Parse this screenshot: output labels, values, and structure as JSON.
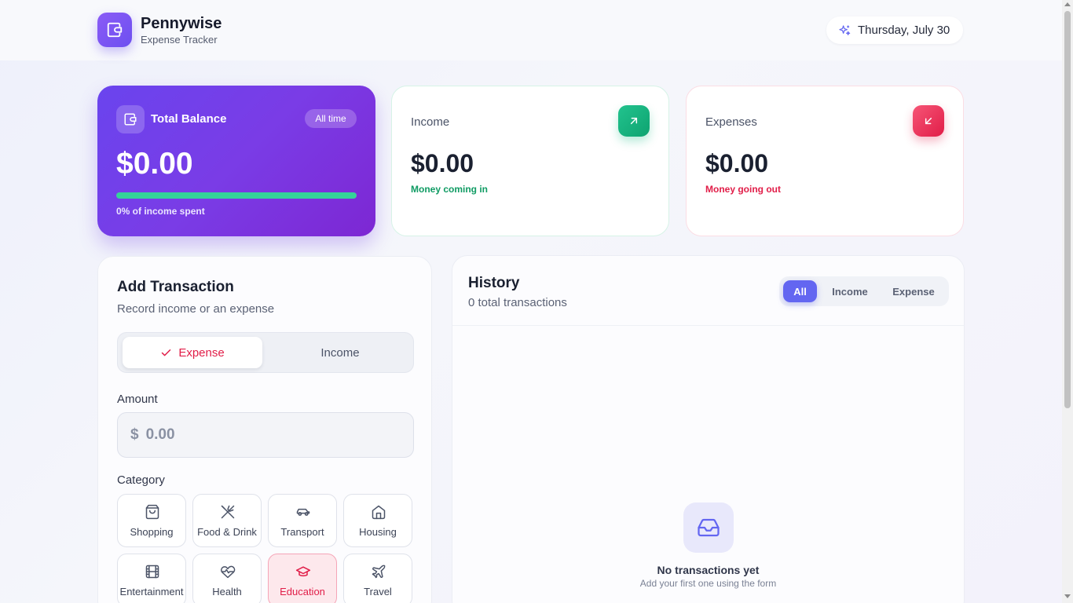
{
  "app": {
    "name": "Pennywise",
    "subtitle": "Expense Tracker",
    "date": "Thursday, July 30",
    "logo_icon": "wallet-icon",
    "date_icon": "sparkles-icon"
  },
  "balance": {
    "title": "Total Balance",
    "pill": "All time",
    "amount": "$0.00",
    "spent_fraction": 0,
    "note": "0% of income spent",
    "icon": "wallet-icon"
  },
  "income": {
    "label": "Income",
    "amount": "$0.00",
    "note": "Money coming in",
    "icon": "arrow-up-right-icon",
    "color": "#10b981"
  },
  "expenses": {
    "label": "Expenses",
    "amount": "$0.00",
    "note": "Money going out",
    "icon": "arrow-down-left-icon",
    "color": "#e11d48"
  },
  "form": {
    "title": "Add Transaction",
    "subtitle": "Record income or an expense",
    "type_toggle": {
      "expense": "Expense",
      "income": "Income",
      "selected": "Expense"
    },
    "amount_label": "Amount",
    "amount_prefix": "$",
    "amount_placeholder": "0.00",
    "category_label": "Category",
    "categories": [
      {
        "label": "Shopping",
        "icon": "shopping-bag-icon"
      },
      {
        "label": "Food & Drink",
        "icon": "utensils-icon"
      },
      {
        "label": "Transport",
        "icon": "car-icon"
      },
      {
        "label": "Housing",
        "icon": "home-icon"
      },
      {
        "label": "Entertainment",
        "icon": "film-icon"
      },
      {
        "label": "Health",
        "icon": "heart-pulse-icon"
      },
      {
        "label": "Education",
        "icon": "graduation-cap-icon"
      },
      {
        "label": "Travel",
        "icon": "plane-icon"
      }
    ],
    "selected_category": "Education"
  },
  "history": {
    "title": "History",
    "count": "0 total transactions",
    "filters": [
      "All",
      "Income",
      "Expense"
    ],
    "active_filter": "All",
    "empty_title": "No transactions yet",
    "empty_sub": "Add your first one using the form",
    "empty_icon": "inbox-icon"
  },
  "colors": {
    "accent": "#6366f1",
    "balance_gradient_start": "#6a44ee",
    "balance_gradient_end": "#7d27d3",
    "progress": "#34d399"
  }
}
